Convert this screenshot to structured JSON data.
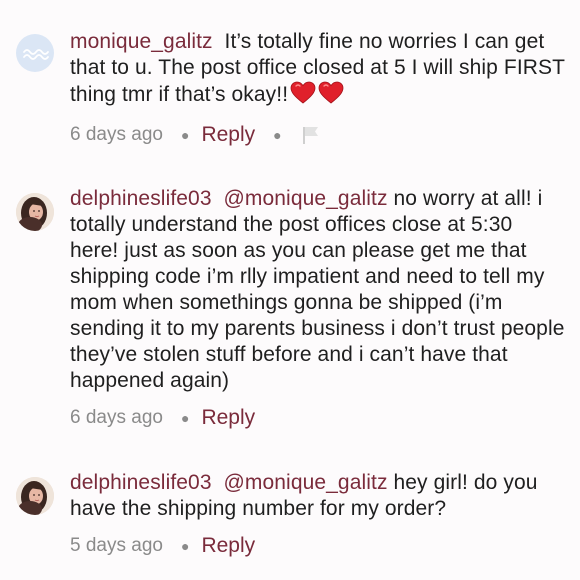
{
  "comments": [
    {
      "username": "monique_galitz",
      "avatar": "wave-icon",
      "text_line_a": "It’s totally fine no worries I can",
      "text_rest": "get that to u. The post office closed at 5 I will ship FIRST thing tmr if that’s okay!!",
      "emoji": [
        "red-heart",
        "red-heart"
      ],
      "time": "6 days ago",
      "reply_label": "Reply",
      "has_flag": true
    },
    {
      "username": "delphineslife03",
      "avatar": "user-photo",
      "mention": "@monique_galitz",
      "text": "no worry at all! i totally understand the post offices close at 5:30 here! just as soon as you can please get me that shipping code i’m rlly impatient and need to tell my mom when somethings gonna be shipped (i’m sending it to my parents business i don’t trust people they’ve stolen stuff before and i can’t have that happened again)",
      "time": "6 days ago",
      "reply_label": "Reply"
    },
    {
      "username": "delphineslife03",
      "avatar": "user-photo",
      "mention": "@monique_galitz",
      "text": "hey girl! do you have the shipping number for my order?",
      "time": "5 days ago",
      "reply_label": "Reply"
    }
  ],
  "colors": {
    "accent": "#7a2b3b",
    "meta": "#8a8a8a",
    "text": "#1f1f1f",
    "heart": "#e0202b"
  }
}
